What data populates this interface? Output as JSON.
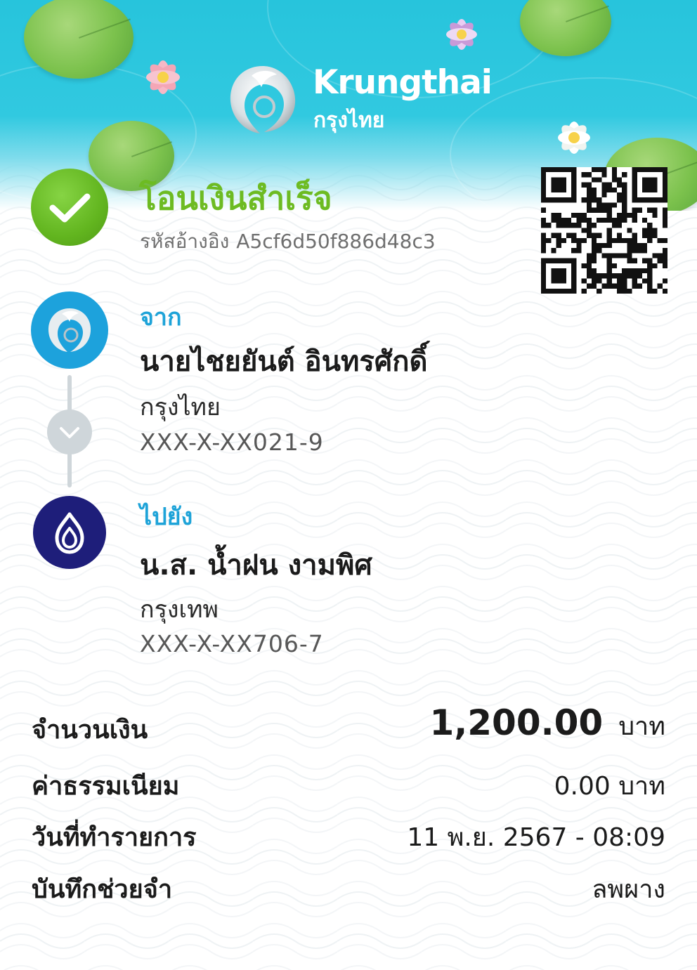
{
  "header": {
    "brand_en": "Krungthai",
    "brand_th": "กรุงไทย",
    "colors": {
      "sky": "#27c4dc",
      "lily_pad": "#7cc24d",
      "lotus": "#f4a6b6"
    }
  },
  "status": {
    "title": "โอนเงินสำเร็จ",
    "ref_label": "รหัสอ้างอิง",
    "ref_code": "A5cf6d50f886d48c3",
    "icon": "check-icon",
    "color": "#6dbb22"
  },
  "qr": {
    "icon": "qr-code"
  },
  "from": {
    "label": "จาก",
    "name": "นายไชยยันต์ อินทรศักดิ์",
    "bank": "กรุงไทย",
    "account": "XXX-X-XX021-9",
    "icon": "krungthai-bird-logo",
    "color": "#1da2dc"
  },
  "connector": {
    "icon": "chevron-down-icon"
  },
  "to": {
    "label": "ไปยัง",
    "name": "น.ส. น้ำฝน งามพิศ",
    "bank": "กรุงเทพ",
    "account": "XXX-X-XX706-7",
    "icon": "bangkok-bank-lotus-logo",
    "color": "#1e1e7a"
  },
  "details": {
    "amount_label": "จำนวนเงิน",
    "amount_value": "1,200.00",
    "amount_unit": "บาท",
    "fee_label": "ค่าธรรมเนียม",
    "fee_value": "0.00 บาท",
    "date_label": "วันที่ทำรายการ",
    "date_value": "11 พ.ย. 2567 - 08:09",
    "memo_label": "บันทึกช่วยจำ",
    "memo_value": "ลพผาง"
  }
}
